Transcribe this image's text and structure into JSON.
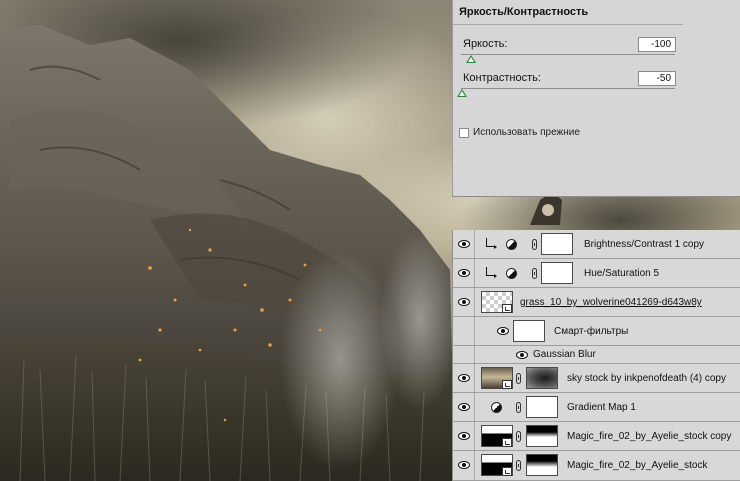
{
  "adjustments": {
    "title": "Яркость/Контрастность",
    "brightness_label": "Яркость:",
    "brightness_value": "-100",
    "contrast_label": "Контрастность:",
    "contrast_value": "-50",
    "use_legacy_label": "Использовать прежние",
    "use_legacy_checked": false,
    "accent_color": "#2a8a3a"
  },
  "layers": [
    {
      "name": "Brightness/Contrast 1 copy",
      "type": "adjustment",
      "clipped": true,
      "icon": "adjustment-circle-icon"
    },
    {
      "name": "Hue/Saturation 5",
      "type": "adjustment",
      "clipped": true,
      "icon": "adjustment-circle-icon"
    },
    {
      "name": "grass_10_by_wolverine041269-d643w8y",
      "type": "smart-object",
      "icon": "smart-object-icon"
    },
    {
      "name": "Смарт-фильтры",
      "type": "smart-filters",
      "icon": "filter-mask-icon"
    },
    {
      "name": "Gaussian Blur",
      "type": "filter",
      "icon": "eye-icon"
    },
    {
      "name": "sky stock by inkpenofdeath (4) copy",
      "type": "masked-smart-object",
      "icon": "smart-object-icon"
    },
    {
      "name": "Gradient Map 1",
      "type": "adjustment",
      "icon": "adjustment-circle-icon"
    },
    {
      "name": "Magic_fire_02_by_Ayelie_stock copy",
      "type": "masked-smart-object",
      "icon": "smart-object-icon"
    },
    {
      "name": "Magic_fire_02_by_Ayelie_stock",
      "type": "masked-smart-object",
      "icon": "smart-object-icon"
    }
  ]
}
